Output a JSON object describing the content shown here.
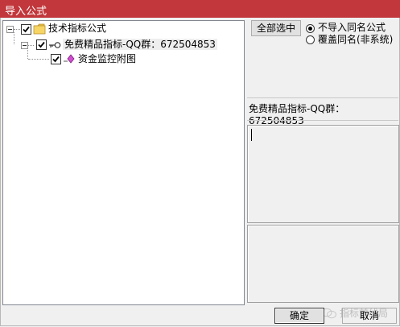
{
  "window": {
    "title": "导入公式"
  },
  "tree": {
    "root": {
      "label": "技术指标公式",
      "checked": true,
      "icon": "folder-icon"
    },
    "child": {
      "label": "免费精品指标-QQ群：672504853",
      "checked": true,
      "icon": "key-icon"
    },
    "leaf": {
      "label": "资金监控附图",
      "checked": true,
      "icon": "diamond-icon"
    }
  },
  "options": {
    "select_all_label": "全部选中",
    "radio_skip_label": "不导入同名公式",
    "radio_overwrite_label": "覆盖同名(非系统)",
    "selected": "radio_skip"
  },
  "detail": {
    "name": "免费精品指标-QQ群：672504853"
  },
  "footer": {
    "ok_label": "确定",
    "cancel_label": "取消",
    "watermark": "指标前线局"
  },
  "colors": {
    "titlebar": "#c1373b",
    "background": "#f0f0f0"
  }
}
